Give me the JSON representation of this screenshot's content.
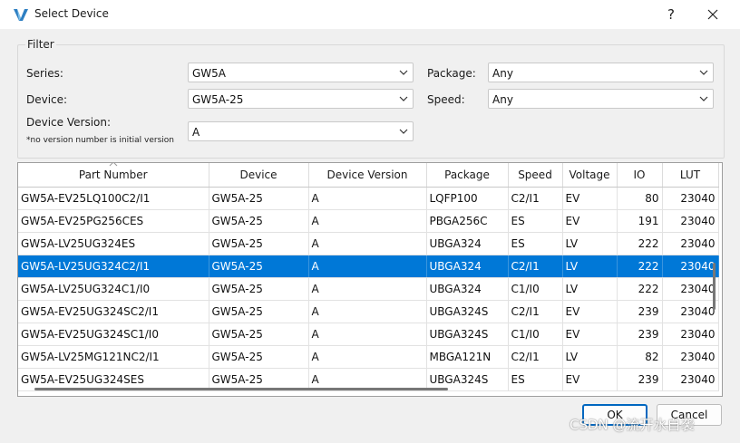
{
  "window": {
    "title": "Select Device",
    "help": "?"
  },
  "filter": {
    "label": "Filter",
    "series_label": "Series:",
    "series_value": "GW5A",
    "device_label": "Device:",
    "device_value": "GW5A-25",
    "version_label": "Device Version:",
    "version_value": "A",
    "version_note": "*no version number is initial version",
    "package_label": "Package:",
    "package_value": "Any",
    "speed_label": "Speed:",
    "speed_value": "Any"
  },
  "table": {
    "columns": [
      "Part Number",
      "Device",
      "Device Version",
      "Package",
      "Speed",
      "Voltage",
      "IO",
      "LUT"
    ],
    "rows": [
      [
        "GW5A-EV25LQ100C2/I1",
        "GW5A-25",
        "A",
        "LQFP100",
        "C2/I1",
        "EV",
        "80",
        "23040"
      ],
      [
        "GW5A-EV25PG256CES",
        "GW5A-25",
        "A",
        "PBGA256C",
        "ES",
        "EV",
        "191",
        "23040"
      ],
      [
        "GW5A-LV25UG324ES",
        "GW5A-25",
        "A",
        "UBGA324",
        "ES",
        "LV",
        "222",
        "23040"
      ],
      [
        "GW5A-LV25UG324C2/I1",
        "GW5A-25",
        "A",
        "UBGA324",
        "C2/I1",
        "LV",
        "222",
        "23040"
      ],
      [
        "GW5A-LV25UG324C1/I0",
        "GW5A-25",
        "A",
        "UBGA324",
        "C1/I0",
        "LV",
        "222",
        "23040"
      ],
      [
        "GW5A-EV25UG324SC2/I1",
        "GW5A-25",
        "A",
        "UBGA324S",
        "C2/I1",
        "EV",
        "239",
        "23040"
      ],
      [
        "GW5A-EV25UG324SC1/I0",
        "GW5A-25",
        "A",
        "UBGA324S",
        "C1/I0",
        "EV",
        "239",
        "23040"
      ],
      [
        "GW5A-LV25MG121NC2/I1",
        "GW5A-25",
        "A",
        "MBGA121N",
        "C2/I1",
        "LV",
        "82",
        "23040"
      ],
      [
        "GW5A-EV25UG324SES",
        "GW5A-25",
        "A",
        "UBGA324S",
        "ES",
        "EV",
        "239",
        "23040"
      ]
    ],
    "selected_row": 3
  },
  "buttons": {
    "ok": "OK",
    "cancel": "Cancel"
  },
  "watermark": "CSDN @流开水自袭",
  "colors": {
    "selection": "#0078d7",
    "ok_border": "#0067c0"
  }
}
